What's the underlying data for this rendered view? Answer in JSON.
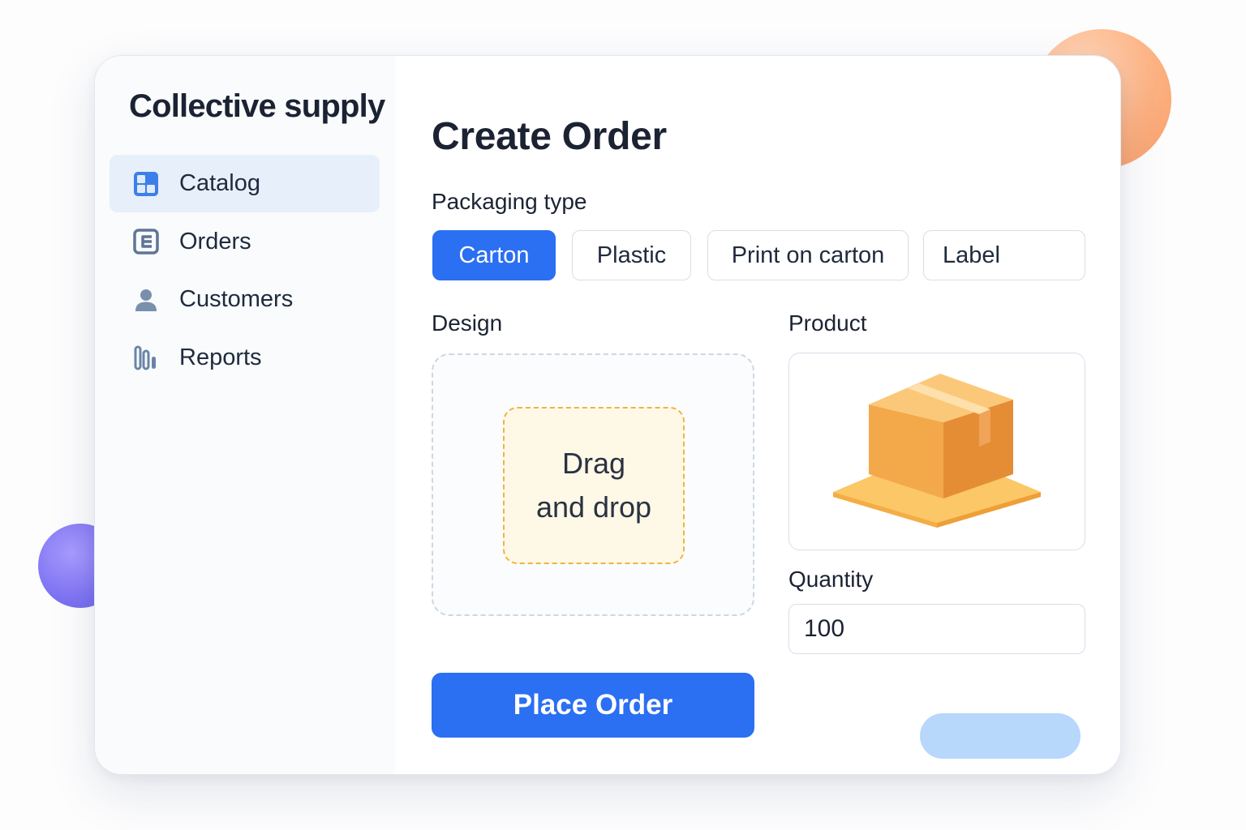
{
  "app": {
    "title": "Collective supply"
  },
  "sidebar": {
    "items": [
      {
        "label": "Catalog",
        "icon": "catalog-grid-icon",
        "active": true
      },
      {
        "label": "Orders",
        "icon": "orders-document-icon",
        "active": false
      },
      {
        "label": "Customers",
        "icon": "customer-person-icon",
        "active": false
      },
      {
        "label": "Reports",
        "icon": "reports-bar-chart-icon",
        "active": false
      }
    ]
  },
  "main": {
    "title": "Create Order",
    "packaging": {
      "label": "Packaging type",
      "options": [
        "Carton",
        "Plastic",
        "Print on carton",
        "Label"
      ],
      "selected": "Carton"
    },
    "design": {
      "label": "Design",
      "drop_line1": "Drag",
      "drop_line2": "and drop"
    },
    "product": {
      "label": "Product",
      "image": "carton-box-icon"
    },
    "quantity": {
      "label": "Quantity",
      "value": "100"
    },
    "place_order_label": "Place Order"
  },
  "colors": {
    "accent": "#2b6ff2",
    "sidebar_active_bg": "#e7effb",
    "drop_target_border": "#f1b43f",
    "drop_target_bg": "#fef8e6",
    "icon_blue": "#3d7fe8",
    "icon_slate": "#5f7593"
  }
}
